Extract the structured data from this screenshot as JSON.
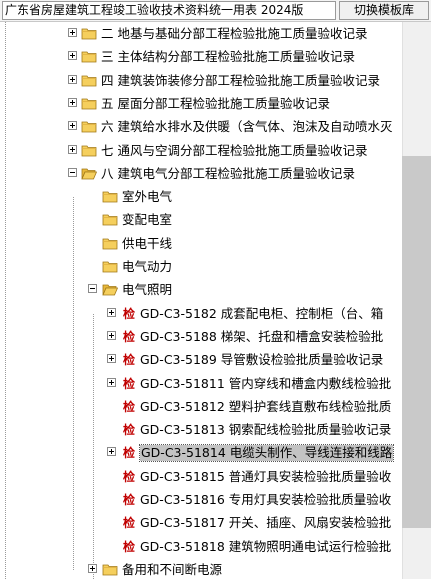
{
  "window": {
    "title": "广东省房屋建筑工程竣工验收技术资料统一用表 2024版",
    "switch_button": "切换模板库"
  },
  "tree": {
    "sections": [
      {
        "label": "二 地基与基础分部工程检验批施工质量验收记录"
      },
      {
        "label": "三 主体结构分部工程检验批施工质量验收记录"
      },
      {
        "label": "四 建筑装饰装修分部工程检验批施工质量验收记录"
      },
      {
        "label": "五 屋面分部工程检验批施工质量验收记录"
      },
      {
        "label": "六 建筑给水排水及供暖（含气体、泡沫及自动喷水灭"
      },
      {
        "label": "七 通风与空调分部工程检验批施工质量验收记录"
      },
      {
        "label": "八 建筑电气分部工程检验批施工质量验收记录"
      }
    ],
    "subsections": [
      {
        "label": "室外电气"
      },
      {
        "label": "变配电室"
      },
      {
        "label": "供电干线"
      },
      {
        "label": "电气动力"
      },
      {
        "label": "电气照明"
      }
    ],
    "forms": [
      {
        "badge": "检",
        "label": "GD-C3-5182 成套配电柜、控制柜（台、箱"
      },
      {
        "badge": "检",
        "label": "GD-C3-5188 梯架、托盘和槽盒安装检验批"
      },
      {
        "badge": "检",
        "label": "GD-C3-5189 导管敷设检验批质量验收记录"
      },
      {
        "badge": "检",
        "label": "GD-C3-51811 管内穿线和槽盒内敷线检验批"
      },
      {
        "badge": "检",
        "label": "GD-C3-51812 塑料护套线直敷布线检验批质"
      },
      {
        "badge": "检",
        "label": "GD-C3-51813 钢索配线检验批质量验收记录"
      },
      {
        "badge": "检",
        "label": "GD-C3-51814 电缆头制作、导线连接和线路"
      },
      {
        "badge": "检",
        "label": "GD-C3-51815 普通灯具安装检验批质量验收"
      },
      {
        "badge": "检",
        "label": "GD-C3-51816 专用灯具安装检验批质量验收"
      },
      {
        "badge": "检",
        "label": "GD-C3-51817 开关、插座、风扇安装检验批"
      },
      {
        "badge": "检",
        "label": "GD-C3-51818 建筑物照明通电试运行检验批"
      }
    ],
    "last_item": {
      "label": "备用和不间断电源"
    }
  },
  "colors": {
    "badge": "#c00000",
    "selection": "#c3c3c3",
    "folder": "#f5cf5d"
  }
}
